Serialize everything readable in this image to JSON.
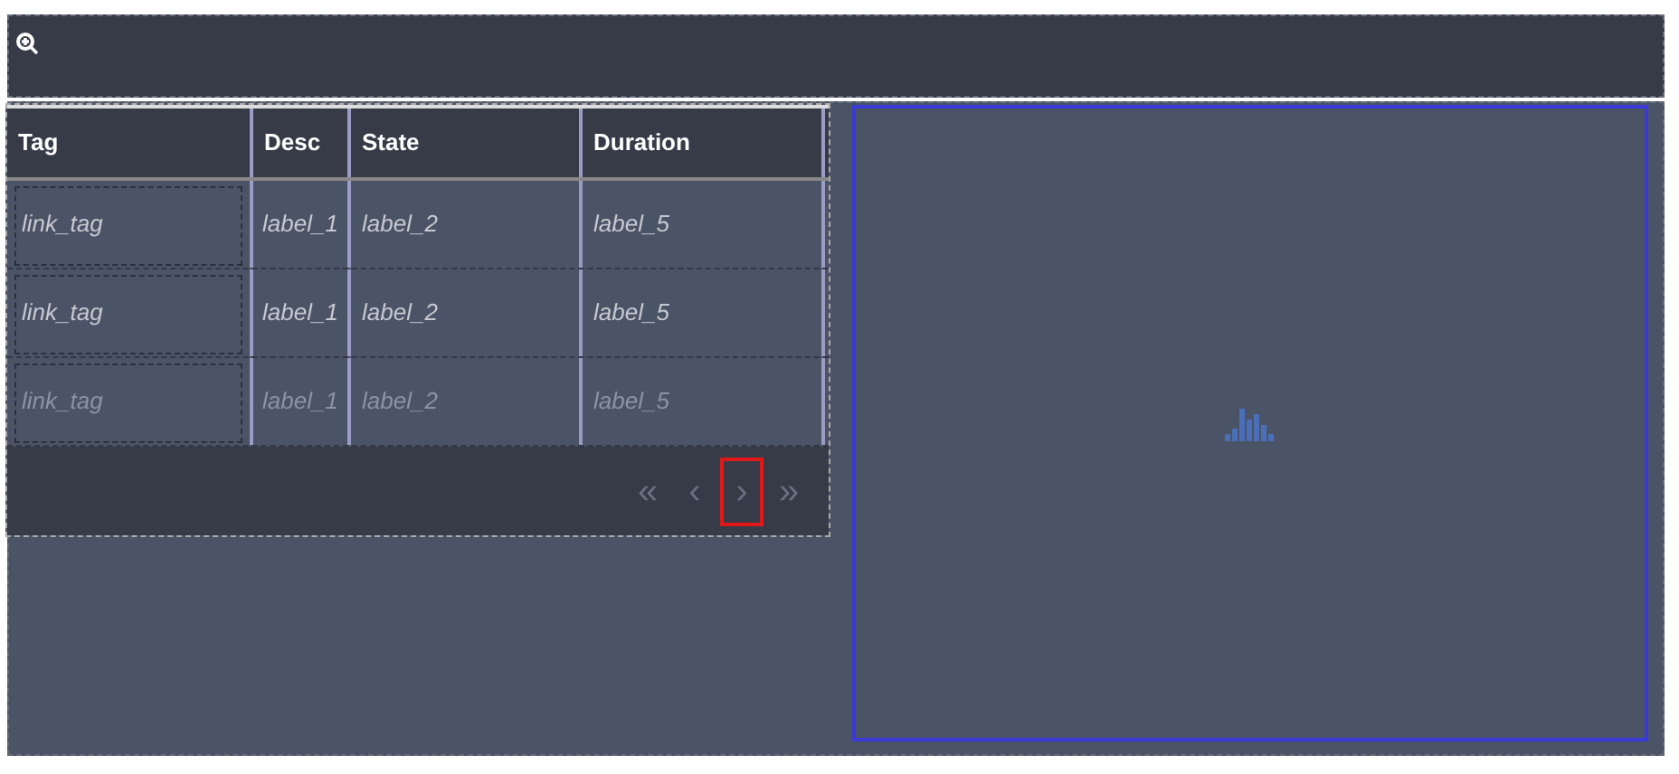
{
  "table": {
    "columns": [
      "Tag",
      "Desc",
      "State",
      "Duration"
    ],
    "rows": [
      {
        "cells": [
          "link_tag",
          "label_1",
          "label_2",
          "label_5"
        ],
        "disabled": false
      },
      {
        "cells": [
          "link_tag",
          "label_1",
          "label_2",
          "label_5"
        ],
        "disabled": false
      },
      {
        "cells": [
          "link_tag",
          "label_1",
          "label_2",
          "label_5"
        ],
        "disabled": true
      }
    ]
  },
  "pager": [
    {
      "symbol": "«",
      "focused": false
    },
    {
      "symbol": "‹",
      "focused": false
    },
    {
      "symbol": "›",
      "focused": true
    },
    {
      "symbol": "»",
      "focused": false
    }
  ],
  "chart_panel": {
    "selected": true
  }
}
